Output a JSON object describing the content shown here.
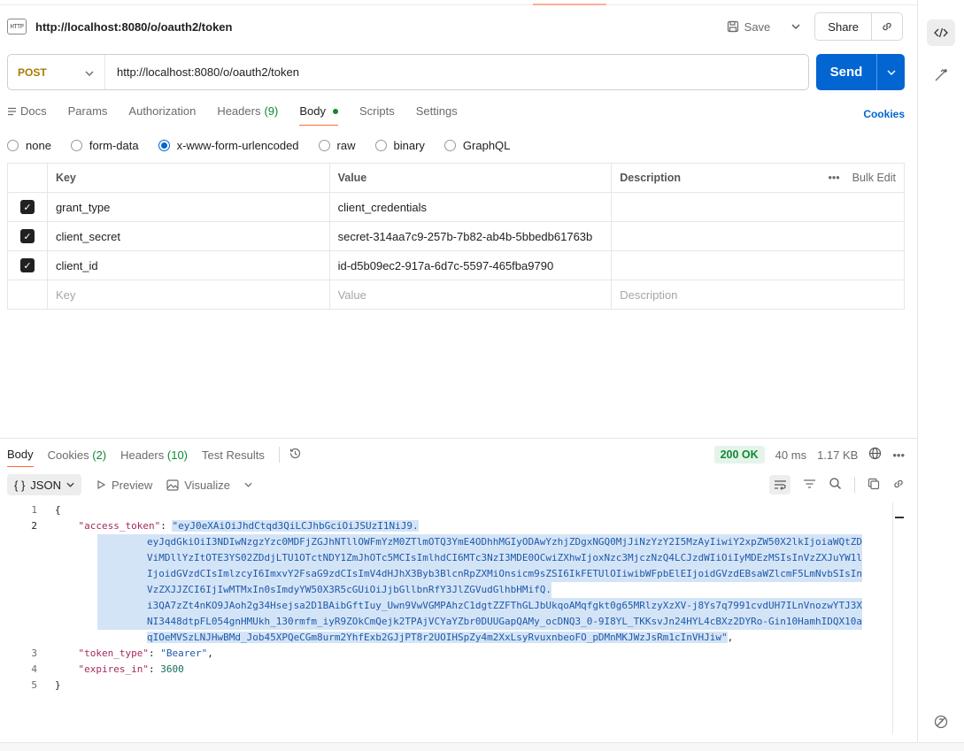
{
  "request": {
    "title": "http://localhost:8080/o/oauth2/token",
    "http_icon_label": "HTTP",
    "save_label": "Save",
    "share_label": "Share",
    "method": "POST",
    "url": "http://localhost:8080/o/oauth2/token",
    "send_label": "Send"
  },
  "req_tabs": {
    "docs": "Docs",
    "params": "Params",
    "authorization": "Authorization",
    "headers": "Headers",
    "headers_count": "(9)",
    "body": "Body",
    "scripts": "Scripts",
    "settings": "Settings",
    "cookies": "Cookies"
  },
  "body_types": {
    "none": "none",
    "form_data": "form-data",
    "urlencoded": "x-www-form-urlencoded",
    "raw": "raw",
    "binary": "binary",
    "graphql": "GraphQL",
    "selected": "x-www-form-urlencoded"
  },
  "params_table": {
    "headers": {
      "key": "Key",
      "value": "Value",
      "description": "Description",
      "bulk_edit": "Bulk Edit"
    },
    "rows": [
      {
        "checked": true,
        "key": "grant_type",
        "value": "client_credentials",
        "description": ""
      },
      {
        "checked": true,
        "key": "client_secret",
        "value": "secret-314aa7c9-257b-7b82-ab4b-5bbedb61763b",
        "description": ""
      },
      {
        "checked": true,
        "key": "client_id",
        "value": "id-d5b09ec2-917a-6d7c-5597-465fba9790",
        "description": ""
      }
    ],
    "placeholder": {
      "key": "Key",
      "value": "Value",
      "description": "Description"
    }
  },
  "response": {
    "tabs": {
      "body": "Body",
      "cookies": "Cookies",
      "cookies_count": "(2)",
      "headers": "Headers",
      "headers_count": "(10)",
      "test_results": "Test Results"
    },
    "status": "200 OK",
    "time": "40 ms",
    "size": "1.17 KB",
    "format": "JSON",
    "preview_label": "Preview",
    "visualize_label": "Visualize",
    "json": {
      "open_brace": "{",
      "close_brace": "}",
      "access_token_key": "\"access_token\"",
      "access_token_lines": [
        "\"eyJ0eXAiOiJhdCtqd3QiLCJhbGciOiJSUzI1NiJ9.",
        "eyJqdGkiOiI3NDIwNzgzYzc0MDFjZGJhNTllOWFmYzM0ZTlmOTQ3YmE4ODhhMGIyODAwYzhjZDgxNGQ0MjJiNzYzY2I5MzAyIiwiY2xpZW50X2lkIjoiaWQtZD",
        "ViMDllYzItOTE3YS02ZDdjLTU1OTctNDY1ZmJhOTc5MCIsImlhdCI6MTc3NzI3MDE0OCwiZXhwIjoxNzc3MjczNzQ4LCJzdWIiOiIyMDEzMSIsInVzZXJuYW1l",
        "IjoidGVzdCIsImlzcyI6ImxvY2FsaG9zdCIsImV4dHJhX3Byb3BlcnRpZXMiOnsicm9sZSI6IkFETUlOIiwibWFpbElEIjoidGVzdEBsaWZlcmF5LmNvbSIsIn",
        "VzZXJJZCI6IjIwMTMxIn0sImdyYW50X3R5cGUiOiJjbGllbnRfY3JlZGVudGlhbHMifQ.",
        "i3QA7zZt4nKO9JAoh2g34Hsejsa2D1BAibGftIuy_Uwn9VwVGMPAhzC1dgtZZFThGLJbUkqoAMqfgkt0g65MRlzyXzXV-j8Ys7q7991cvdUH7ILnVnozwYTJ3X",
        "NI3448dtpFL054gnHMUkh_130rmfm_iyR9ZOkCmQejk2TPAjVCYaYZbr0DUUGapQAMy_ocDNQ3_0-9I8YL_TKKsvJn24HYL4cBXz2DYRo-Gin10HamhIDQX10a",
        "qIOeMVSzLNJHwBMd_Job45XPQeCGm8urm2YhfExb2GJjPT8r2UOIHSpZy4m2XxLsyRvuxnbeoFO_pDMnMKJWzJsRm1cInVHJiw\""
      ],
      "token_type_key": "\"token_type\"",
      "token_type_value": "\"Bearer\"",
      "expires_in_key": "\"expires_in\"",
      "expires_in_value": "3600"
    },
    "line_numbers": [
      "1",
      "2",
      "3",
      "4",
      "5"
    ]
  },
  "colors": {
    "accent": "#ff6c37",
    "send": "#0265d2",
    "status_ok": "#0e8a31",
    "method_post": "#ad7a03"
  },
  "icons": [
    "http-icon",
    "save-icon",
    "chevron-down-icon",
    "link-icon",
    "code-icon",
    "magic-icon",
    "docs-icon",
    "history-icon",
    "globe-icon",
    "more-icon",
    "play-icon",
    "image-icon",
    "wrap-icon",
    "filter-icon",
    "search-icon",
    "copy-icon",
    "help-icon"
  ]
}
